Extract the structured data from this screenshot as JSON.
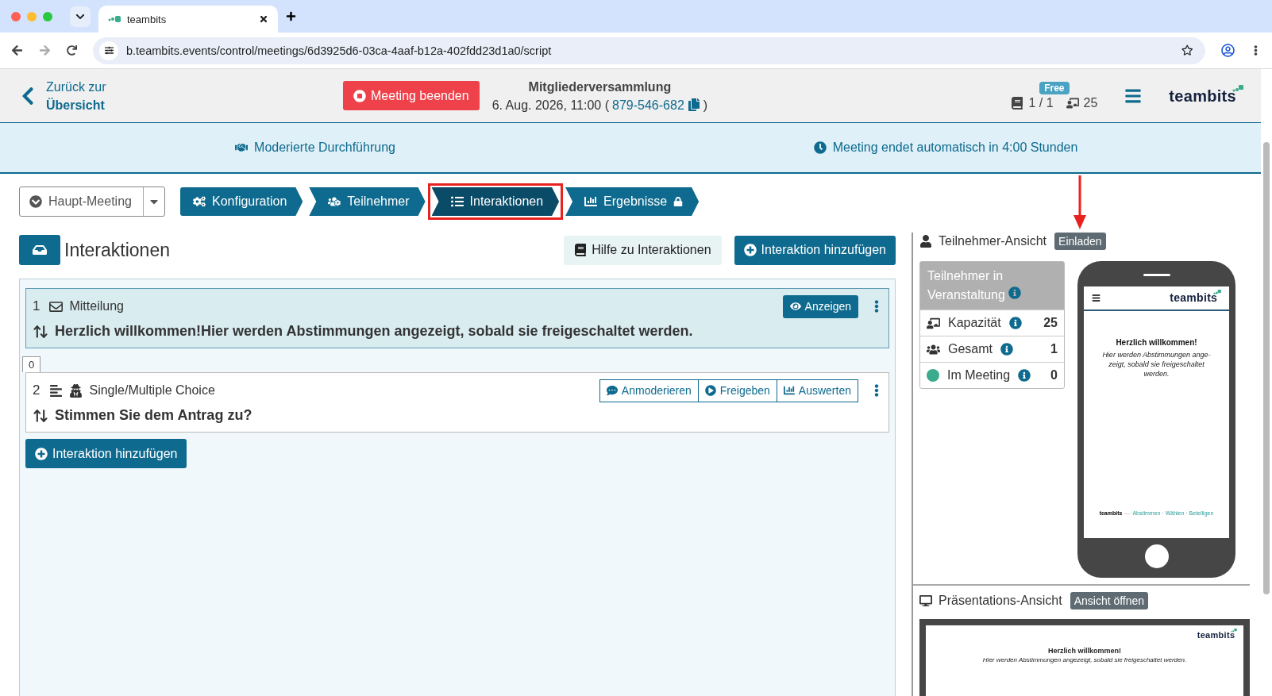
{
  "browser": {
    "tab_title": "teambits",
    "url": "b.teambits.events/control/meetings/6d3925d6-03ca-4aaf-b12a-402fdd23d1a0/script"
  },
  "header": {
    "back_line1": "Zurück zur",
    "back_line2": "Übersicht",
    "end_button": "Meeting beenden",
    "meeting_title": "Mitgliederversammlung",
    "meeting_date": "6. Aug. 2026, 11:00 (",
    "meeting_code": "879-546-682",
    "date_close": ")",
    "plan_badge": "Free",
    "rooms": "1 / 1",
    "capacity": "25",
    "logo": "teambits"
  },
  "banner": {
    "mode": "Moderierte Durchführung",
    "timer": "Meeting endet automatisch in 4:00 Stunden"
  },
  "session_select": "Haupt-Meeting",
  "steps": [
    {
      "label": "Konfiguration",
      "kind": "config",
      "selected": false,
      "highlighted": false,
      "locked": false
    },
    {
      "label": "Teilnehmer",
      "kind": "people",
      "selected": false,
      "highlighted": false,
      "locked": false
    },
    {
      "label": "Interaktionen",
      "kind": "list",
      "selected": true,
      "highlighted": true,
      "locked": false
    },
    {
      "label": "Ergebnisse",
      "kind": "results",
      "selected": false,
      "highlighted": false,
      "locked": true
    }
  ],
  "interactions": {
    "title": "Interaktionen",
    "help_button": "Hilfe zu Interaktionen",
    "add_button": "Interaktion hinzufügen",
    "add_button_bottom": "Interaktion hinzufügen",
    "separator_count": "0",
    "items": [
      {
        "number": "1",
        "kind": "message",
        "type_label": "Mitteilung",
        "text": "Herzlich willkommen!Hier werden Abstimmungen angezeigt, sobald sie freigeschaltet werden.",
        "selected": true,
        "anonymous": false,
        "actions": [
          {
            "label": "Anzeigen",
            "kind": "show"
          }
        ]
      },
      {
        "number": "2",
        "kind": "choice",
        "type_label": "Single/Multiple Choice",
        "text": "Stimmen Sie dem Antrag zu?",
        "selected": false,
        "anonymous": true,
        "actions": [
          {
            "label": "Anmoderieren",
            "kind": "announce"
          },
          {
            "label": "Freigeben",
            "kind": "release"
          },
          {
            "label": "Auswerten",
            "kind": "evaluate"
          }
        ]
      }
    ]
  },
  "participant_view": {
    "title": "Teilnehmer-Ansicht",
    "invite_button": "Einladen",
    "invite_arrow": true,
    "stats_title": "Teilnehmer in Veranstaltung",
    "stats": [
      {
        "label": "Kapazität",
        "value": "25",
        "kind": "capacity"
      },
      {
        "label": "Gesamt",
        "value": "1",
        "kind": "total"
      },
      {
        "label": "Im Meeting",
        "value": "0",
        "kind": "online",
        "color": "#3aab8c"
      }
    ],
    "phone": {
      "logo": "teambits",
      "heading": "Herzlich willkommen!",
      "body": "Hier werden Abstimmungen ange-zeigt, sobald sie freigeschaltet werden.",
      "footer_brand": "teambits",
      "footer_sep": "—",
      "footer_tagline": "Abstimmen · Wählen · Beteiligen"
    }
  },
  "presentation_view": {
    "title": "Präsentations-Ansicht",
    "open_button": "Ansicht öffnen",
    "logo": "teambits",
    "heading": "Herzlich willkommen!",
    "body": "Hier werden Abstimmungen angezeigt, sobald sie freigeschaltet werden."
  }
}
